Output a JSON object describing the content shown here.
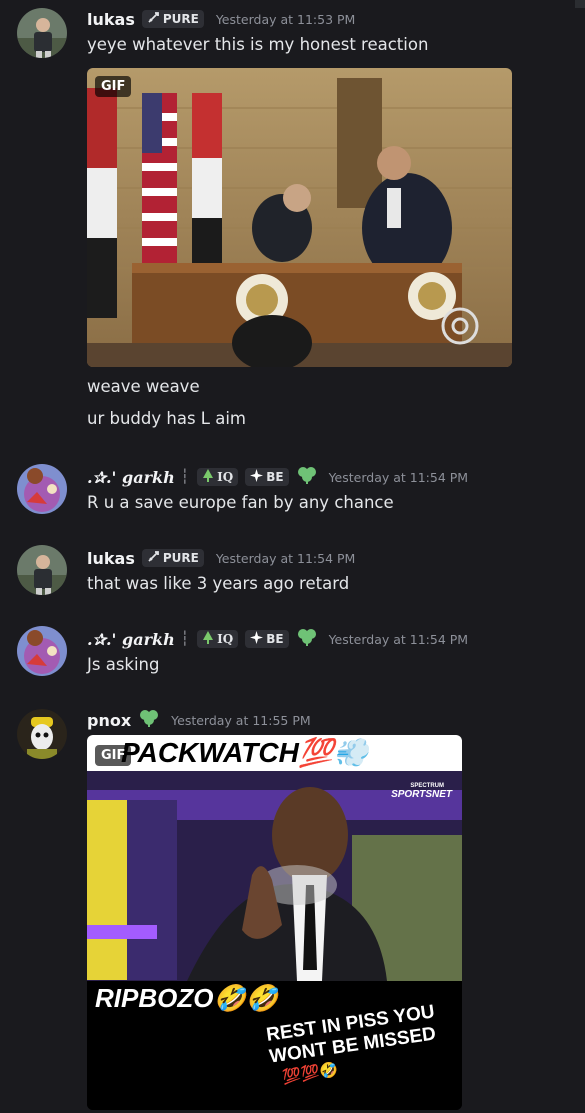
{
  "messages": [
    {
      "author": "lukas",
      "tag": "PURE",
      "timestamp": "Yesterday at 11:53 PM",
      "lines": [
        "yeye whatever this is my honest reaction"
      ],
      "gif_badge": "GIF",
      "after_lines": [
        "weave weave",
        "ur buddy has L aim"
      ]
    },
    {
      "author": ".✰.' garkh",
      "sep": "┆",
      "tag1": "IQ",
      "tag2": "BE",
      "timestamp": "Yesterday at 11:54 PM",
      "lines": [
        "R u a save europe fan by any chance"
      ]
    },
    {
      "author": "lukas",
      "tag": "PURE",
      "timestamp": "Yesterday at 11:54 PM",
      "lines": [
        "that was like 3 years ago retard"
      ]
    },
    {
      "author": ".✰.' garkh",
      "sep": "┆",
      "tag1": "IQ",
      "tag2": "BE",
      "timestamp": "Yesterday at 11:54 PM",
      "lines": [
        "Js asking"
      ]
    },
    {
      "author": "pnox",
      "timestamp": "Yesterday at 11:55 PM",
      "gif_badge": "GIF",
      "gif_text": {
        "top": "PACKWATCH💯💨",
        "logo_small": "SPECTRUM",
        "logo": "SPORTSNET",
        "mid": "RIPBOZO🤣🤣",
        "bottom1": "REST IN PISS YOU",
        "bottom2": "WONT BE MISSED",
        "bottom3": "💯💯🤣"
      }
    }
  ],
  "icons": [
    "sword-icon",
    "tree-icon",
    "sparkle-icon",
    "clover-icon"
  ]
}
